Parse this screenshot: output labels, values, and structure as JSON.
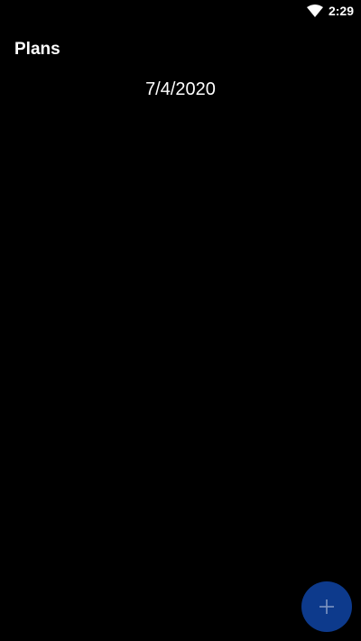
{
  "status_bar": {
    "time": "2:29",
    "wifi_icon": "wifi-icon"
  },
  "header": {
    "title": "Plans"
  },
  "main": {
    "date": "7/4/2020"
  },
  "fab": {
    "icon": "plus-icon",
    "color": "#0d3a8c"
  }
}
